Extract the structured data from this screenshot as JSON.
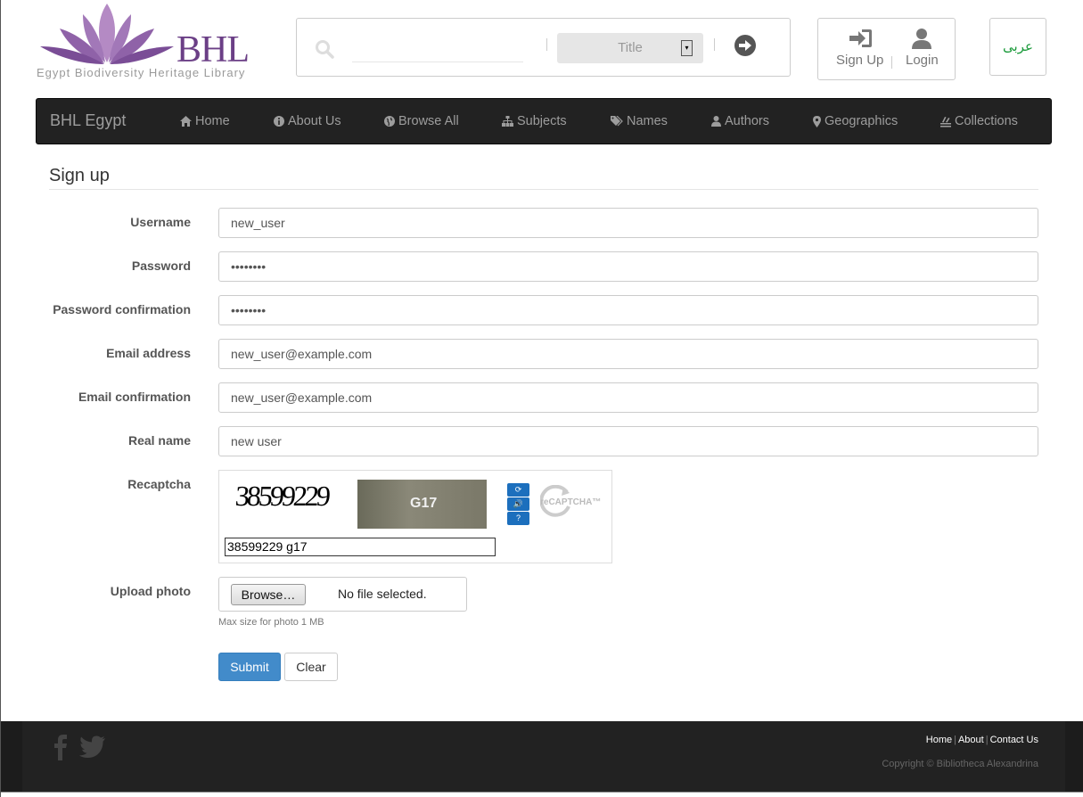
{
  "header": {
    "logo_text": "BHL",
    "logo_subtitle": "Egypt Biodiversity Heritage Library",
    "search": {
      "value": "",
      "select_value": "Title"
    },
    "auth": {
      "signup_label": "Sign Up",
      "login_label": "Login"
    },
    "language_label": "عربى"
  },
  "navbar": {
    "brand": "BHL Egypt",
    "items": [
      {
        "label": "Home",
        "icon": "home-icon"
      },
      {
        "label": "About Us",
        "icon": "info-icon"
      },
      {
        "label": "Browse All",
        "icon": "globe-icon"
      },
      {
        "label": "Subjects",
        "icon": "sitemap-icon"
      },
      {
        "label": "Names",
        "icon": "tags-icon"
      },
      {
        "label": "Authors",
        "icon": "user-icon"
      },
      {
        "label": "Geographics",
        "icon": "map-marker-icon"
      },
      {
        "label": "Collections",
        "icon": "collections-icon"
      }
    ]
  },
  "form": {
    "title": "Sign up",
    "fields": [
      {
        "label": "Username",
        "value": "new_user"
      },
      {
        "label": "Password",
        "value": "••••••••"
      },
      {
        "label": "Password confirmation",
        "value": "••••••••"
      },
      {
        "label": "Email address",
        "value": "new_user@example.com"
      },
      {
        "label": "Email confirmation",
        "value": "new_user@example.com"
      },
      {
        "label": "Real name",
        "value": "new user"
      }
    ],
    "recaptcha": {
      "label": "Recaptcha",
      "image_text": "38599229",
      "photo_text": "G17",
      "logo_text": "reCAPTCHA™",
      "answer": "38599229 g17"
    },
    "upload": {
      "label": "Upload photo",
      "browse_label": "Browse…",
      "status": "No file selected.",
      "help": "Max size for photo 1 MB"
    },
    "submit_label": "Submit",
    "clear_label": "Clear"
  },
  "footer": {
    "links": [
      "Home",
      "About",
      "Contact Us"
    ],
    "copyright": "Copyright © Bibliotheca Alexandrina"
  },
  "colors": {
    "navbar_bg": "#222222",
    "primary": "#428bca",
    "brand_purple": "#6b3f86",
    "language_green": "#1a9a3a"
  }
}
